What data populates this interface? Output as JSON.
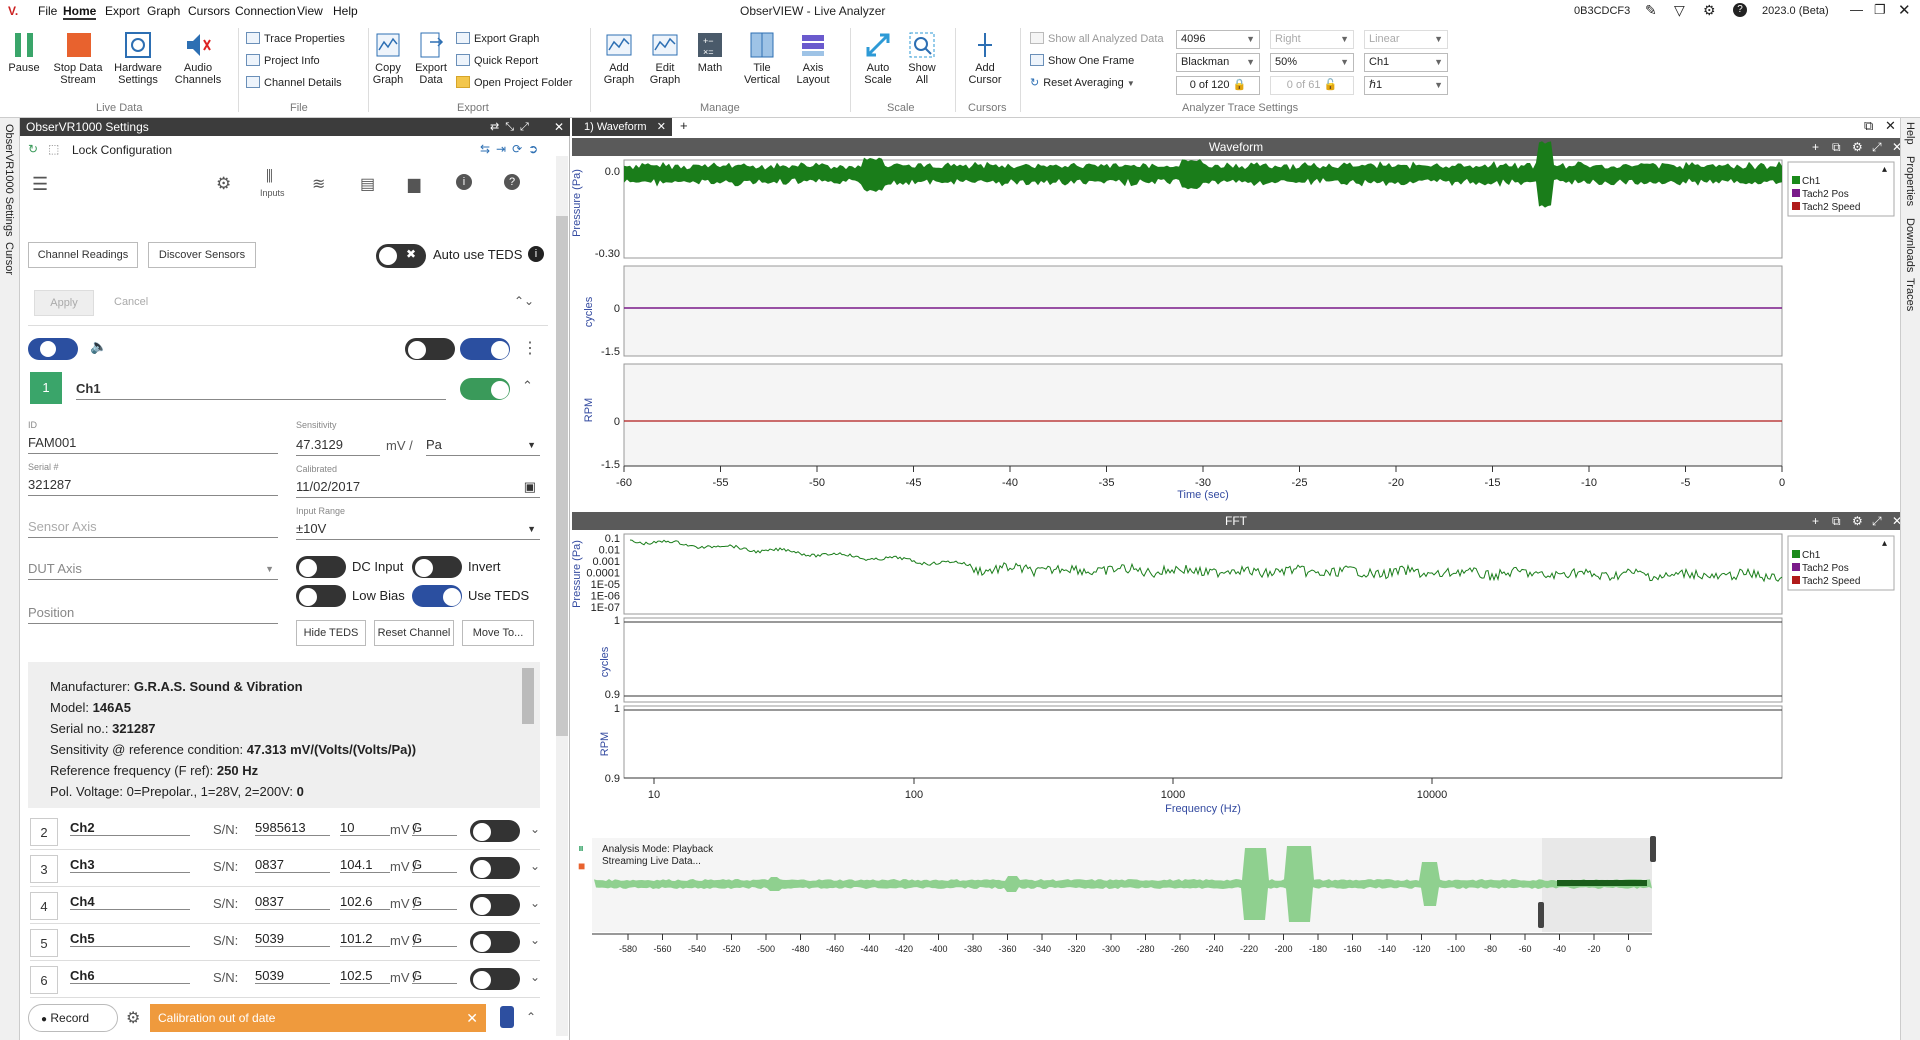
{
  "app": {
    "title": "ObserVIEW - Live Analyzer",
    "device_id": "0B3CDCF3",
    "version": "2023.0 (Beta)"
  },
  "menu": [
    "File",
    "Home",
    "Export",
    "Graph",
    "Cursors",
    "Connection",
    "View",
    "Help"
  ],
  "ribbon": {
    "live_data": {
      "label": "Live Data",
      "pause": "Pause",
      "stop": "Stop Data Stream",
      "hw": "Hardware Settings",
      "audio": "Audio Channels"
    },
    "file": {
      "label": "File",
      "trace_props": "Trace Properties",
      "project_info": "Project Info",
      "channel_details": "Channel Details"
    },
    "export": {
      "label": "Export",
      "copy_graph": "Copy Graph",
      "export_data": "Export Data",
      "export_graph": "Export Graph",
      "quick_report": "Quick Report",
      "open_folder": "Open Project Folder"
    },
    "manage": {
      "label": "Manage",
      "add_graph": "Add Graph",
      "edit_graph": "Edit Graph",
      "math": "Math",
      "tile": "Tile Vertical",
      "axis_layout": "Axis Layout"
    },
    "scale": {
      "label": "Scale",
      "auto": "Auto Scale",
      "show_all": "Show All"
    },
    "cursors": {
      "label": "Cursors",
      "add_cursor": "Add Cursor"
    },
    "trace": {
      "label": "Analyzer Trace Settings",
      "show_all_data": "Show all Analyzed Data",
      "show_one": "Show One Frame",
      "reset_avg": "Reset Averaging",
      "fft_size": "4096",
      "window": "Blackman",
      "frame_count": "0 of 120",
      "side": "Right",
      "overlap": "50%",
      "frame2": "0 of 61",
      "scale": "Linear",
      "channel": "Ch1",
      "channel2": "ℏ1"
    }
  },
  "left_tabs": [
    "ObserVR1000 Settings",
    "Cursor"
  ],
  "right_tabs": [
    "Help",
    "Properties",
    "Downloads",
    "Traces"
  ],
  "panel": {
    "title": "ObserVR1000 Settings",
    "lock": "Lock Configuration",
    "inputs": "Inputs",
    "channel_readings": "Channel Readings",
    "discover": "Discover Sensors",
    "auto_teds": "Auto use TEDS",
    "apply": "Apply",
    "cancel": "Cancel",
    "ch1": {
      "num": "1",
      "name": "Ch1",
      "id_lbl": "ID",
      "id": "FAM001",
      "serial_lbl": "Serial #",
      "serial": "321287",
      "sens_lbl": "Sensitivity",
      "sens": "47.3129",
      "unit": "mV /",
      "unit2": "Pa",
      "cal_lbl": "Calibrated",
      "cal": "11/02/2017",
      "range_lbl": "Input Range",
      "range": "±10V",
      "sensor_axis": "Sensor Axis",
      "dut_axis": "DUT Axis",
      "position": "Position",
      "dc": "DC Input",
      "invert": "Invert",
      "low_bias": "Low Bias",
      "use_teds": "Use TEDS",
      "hide_teds": "Hide TEDS",
      "reset": "Reset Channel",
      "move": "Move To..."
    },
    "teds": [
      {
        "k": "Manufacturer: ",
        "v": "G.R.A.S. Sound & Vibration"
      },
      {
        "k": "Model: ",
        "v": "146A5"
      },
      {
        "k": "Serial no.: ",
        "v": "321287"
      },
      {
        "k": "Sensitivity @ reference condition: ",
        "v": "47.313 mV/(Volts/(Volts/Pa))"
      },
      {
        "k": "Reference frequency (F ref): ",
        "v": "250 Hz"
      },
      {
        "k": "Pol. Voltage: 0=Prepolar., 1=28V, 2=200V: ",
        "v": "0"
      }
    ],
    "channels": [
      {
        "num": "2",
        "name": "Ch2",
        "sn": "5985613",
        "sens": "10",
        "unit": "mV /",
        "g": "G"
      },
      {
        "num": "3",
        "name": "Ch3",
        "sn": "0837",
        "sens": "104.1",
        "unit": "mV /",
        "g": "G"
      },
      {
        "num": "4",
        "name": "Ch4",
        "sn": "0837",
        "sens": "102.6",
        "unit": "mV /",
        "g": "G"
      },
      {
        "num": "5",
        "name": "Ch5",
        "sn": "5039",
        "sens": "101.2",
        "unit": "mV /",
        "g": "G"
      },
      {
        "num": "6",
        "name": "Ch6",
        "sn": "5039",
        "sens": "102.5",
        "unit": "mV /",
        "g": "G"
      }
    ],
    "sn_lbl": "S/N:",
    "record": "Record",
    "alert": "Calibration out of date"
  },
  "tab": "1) Waveform",
  "waveform": {
    "title": "Waveform",
    "ylabel1": "Pressure (Pa)",
    "ylabel2": "cycles",
    "ylabel3": "RPM",
    "y1": [
      "0.0",
      "-0.30"
    ],
    "y2": [
      "0",
      "-1.5"
    ],
    "y3": [
      "0",
      "-1.5"
    ],
    "xticks": [
      "-60",
      "-55",
      "-50",
      "-45",
      "-40",
      "-35",
      "-30",
      "-25",
      "-20",
      "-15",
      "-10",
      "-5",
      "0"
    ],
    "xlabel": "Time (sec)"
  },
  "fft": {
    "title": "FFT",
    "ylabel1": "Pressure (Pa)",
    "ylabel2": "cycles",
    "ylabel3": "RPM",
    "y1": [
      "0.1",
      "0.01",
      "0.001",
      "0.0001",
      "1E-05",
      "1E-06",
      "1E-07"
    ],
    "y2": [
      "1",
      "0.9"
    ],
    "y3": [
      "1",
      "0.9"
    ],
    "xticks": [
      "10",
      "100",
      "1000",
      "10000"
    ],
    "xlabel": "Frequency (Hz)"
  },
  "legend": [
    {
      "name": "Ch1",
      "color": "#1a8a1a"
    },
    {
      "name": "Tach2 Pos",
      "color": "#7a1a8a"
    },
    {
      "name": "Tach2 Speed",
      "color": "#b01a1a"
    }
  ],
  "overview": {
    "mode": "Analysis Mode: Playback",
    "status": "Streaming Live Data...",
    "xticks": [
      "-580",
      "-560",
      "-540",
      "-520",
      "-500",
      "-480",
      "-460",
      "-440",
      "-420",
      "-400",
      "-380",
      "-360",
      "-340",
      "-320",
      "-300",
      "-280",
      "-260",
      "-240",
      "-220",
      "-200",
      "-180",
      "-160",
      "-140",
      "-120",
      "-100",
      "-80",
      "-60",
      "-40",
      "-20",
      "0"
    ]
  }
}
